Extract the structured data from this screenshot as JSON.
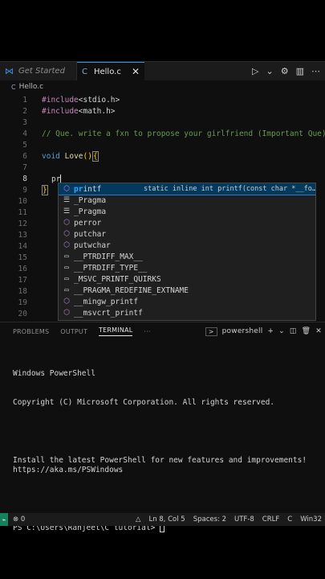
{
  "tabs": {
    "get_started": "Get Started",
    "active": "Hello.c",
    "close": "✕",
    "c_glyph": "C",
    "vscode_glyph": "⋈"
  },
  "breadcrumb": {
    "file": "Hello.c",
    "c_glyph": "C"
  },
  "editor": {
    "line_numbers": [
      "1",
      "2",
      "3",
      "4",
      "5",
      "6",
      "7",
      "8",
      "9",
      "10",
      "11",
      "12",
      "13",
      "14",
      "15",
      "16",
      "17",
      "18",
      "19",
      "20"
    ],
    "lines": {
      "l1_kw": "#include",
      "l1_rest": "<stdio.h>",
      "l2_kw": "#include",
      "l2_rest": "<math.h>",
      "l4": "// Que. write a fxn to propose your girlfriend (Important Que)",
      "l6_type": "void",
      "l6_fn": "Love",
      "l6_paren": "()",
      "l6_brace": "{",
      "l8": "pr",
      "l9": "}"
    }
  },
  "suggest": {
    "items": [
      {
        "match": "pr",
        "rest": "intf",
        "icon": "cube-icon"
      },
      {
        "match": "",
        "rest": "_Pragma",
        "icon": "keyword-icon"
      },
      {
        "match": "",
        "rest": "_Pragma",
        "icon": "keyword-icon"
      },
      {
        "match": "",
        "rest": "perror",
        "icon": "cube-icon"
      },
      {
        "match": "",
        "rest": "putchar",
        "icon": "cube-icon"
      },
      {
        "match": "",
        "rest": "putwchar",
        "icon": "cube-icon"
      },
      {
        "match": "",
        "rest": "__PTRDIFF_MAX__",
        "icon": "macro-icon"
      },
      {
        "match": "",
        "rest": "__PTRDIFF_TYPE__",
        "icon": "macro-icon"
      },
      {
        "match": "",
        "rest": "_MSVC_PRINTF_QUIRKS",
        "icon": "macro-icon"
      },
      {
        "match": "",
        "rest": "__PRAGMA_REDEFINE_EXTNAME",
        "icon": "macro-icon"
      },
      {
        "match": "",
        "rest": "__mingw_printf",
        "icon": "cube-icon"
      },
      {
        "match": "",
        "rest": "__msvcrt_printf",
        "icon": "cube-icon"
      }
    ],
    "detail": "static inline int printf(const char *__fo…"
  },
  "panel": {
    "tabs": [
      "PROBLEMS",
      "OUTPUT",
      "TERMINAL",
      "···"
    ],
    "shell_name": "powershell",
    "terminal_lines": [
      "Windows PowerShell",
      "Copyright (C) Microsoft Corporation. All rights reserved.",
      "",
      "Install the latest PowerShell for new features and improvements! https://aka.ms/PSWindows",
      "",
      "PS C:\\Users\\Ranjeet\\C tutorial> "
    ]
  },
  "statusbar": {
    "errors": "⊗ 0",
    "position": "Ln 8, Col 5",
    "spaces": "Spaces: 2",
    "encoding": "UTF-8",
    "eol": "CRLF",
    "language": "C",
    "platform": "Win32"
  }
}
